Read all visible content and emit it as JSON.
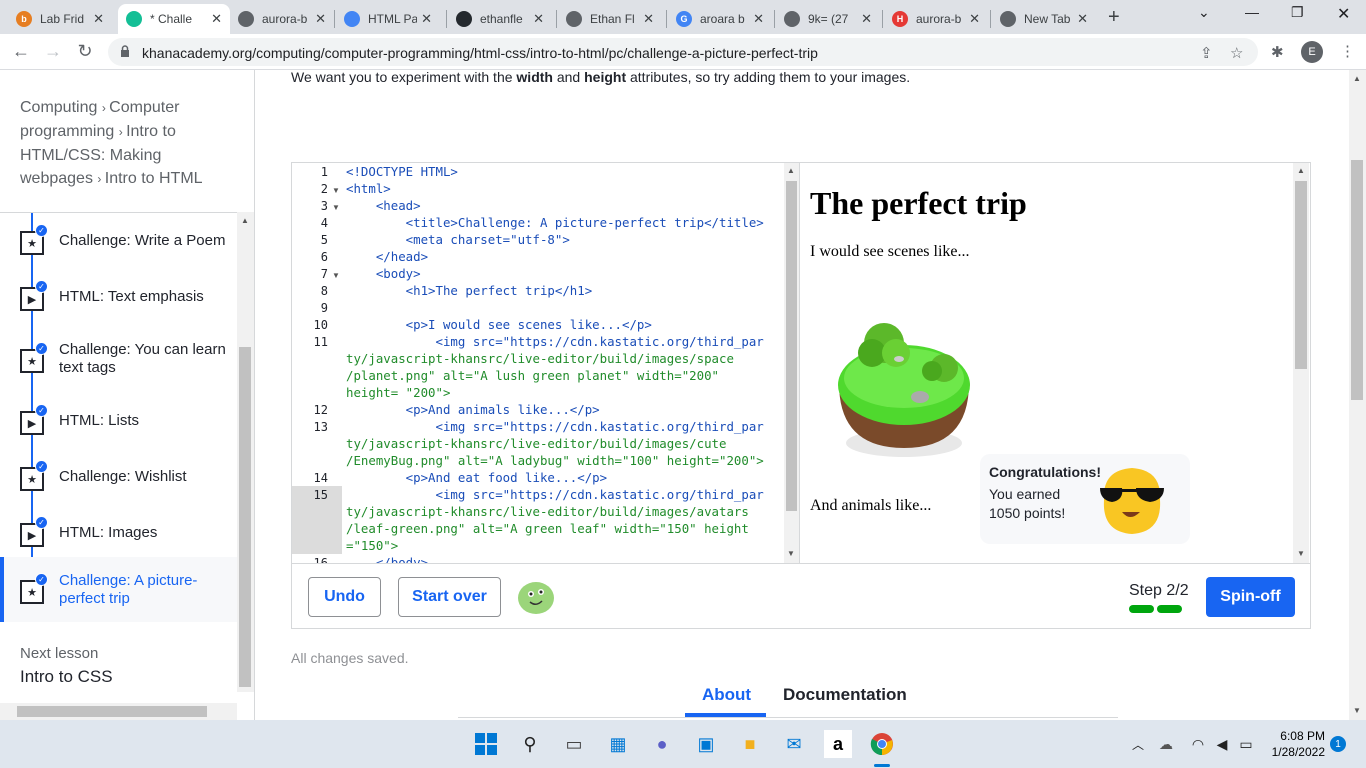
{
  "browser": {
    "tabs": [
      {
        "title": "Lab Frid",
        "icon": "b-icon",
        "color": "#e67e22",
        "glyph": "b",
        "active": false
      },
      {
        "title": "* Challe",
        "icon": "khan-icon",
        "color": "#14bf96",
        "glyph": "",
        "active": true
      },
      {
        "title": "aurora-b",
        "icon": "github-icon",
        "color": "#5f6368",
        "glyph": "",
        "active": false
      },
      {
        "title": "HTML Pa",
        "icon": "docs-icon",
        "color": "#4285f4",
        "glyph": "",
        "active": false
      },
      {
        "title": "ethanfle",
        "icon": "github-icon",
        "color": "#24292e",
        "glyph": "",
        "active": false
      },
      {
        "title": "Ethan Fl",
        "icon": "github-icon",
        "color": "#5f6368",
        "glyph": "",
        "active": false
      },
      {
        "title": "aroara b",
        "icon": "google-icon",
        "color": "#4285f4",
        "glyph": "G",
        "active": false
      },
      {
        "title": "9k= (27",
        "icon": "globe-icon",
        "color": "#5f6368",
        "glyph": "",
        "active": false
      },
      {
        "title": "aurora-b",
        "icon": "h-icon",
        "color": "#e53935",
        "glyph": "H",
        "active": false
      },
      {
        "title": "New Tab",
        "icon": "chrome-icon",
        "color": "#5f6368",
        "glyph": "",
        "active": false
      }
    ],
    "url": "khanacademy.org/computing/computer-programming/html-css/intro-to-html/pc/challenge-a-picture-perfect-trip",
    "profile_initial": "E"
  },
  "sidebar": {
    "breadcrumb": [
      "Computing",
      "Computer programming",
      "Intro to HTML/CSS: Making webpages",
      "Intro to HTML"
    ],
    "items": [
      {
        "label": "Challenge: Write a Poem",
        "type": "challenge",
        "current": false
      },
      {
        "label": "HTML: Text emphasis",
        "type": "talkthrough",
        "current": false
      },
      {
        "label": "Challenge: You can learn text tags",
        "type": "challenge",
        "current": false
      },
      {
        "label": "HTML: Lists",
        "type": "talkthrough",
        "current": false
      },
      {
        "label": "Challenge: Wishlist",
        "type": "challenge",
        "current": false
      },
      {
        "label": "HTML: Images",
        "type": "talkthrough",
        "current": false
      },
      {
        "label": "Challenge: A picture-perfect trip",
        "type": "challenge",
        "current": true
      }
    ],
    "next_lesson_label": "Next lesson",
    "next_lesson_name": "Intro to CSS"
  },
  "content": {
    "intro_pre": "We want you to experiment with the ",
    "intro_b1": "width",
    "intro_mid": " and ",
    "intro_b2": "height",
    "intro_post": " attributes, so try adding them to your images."
  },
  "editor": {
    "line_numbers": [
      "1",
      "2",
      "3",
      "4",
      "5",
      "6",
      "7",
      "8",
      "9",
      "10",
      "11",
      "12",
      "13",
      "14",
      "15",
      "16"
    ],
    "lines": [
      "<!DOCTYPE HTML>",
      "<html>",
      "    <head>",
      "        <title>Challenge: A picture-perfect trip</title>",
      "        <meta charset=\"utf-8\">",
      "    </head>",
      "    <body>",
      "        <h1>The perfect trip</h1>",
      "",
      "        <p>I would see scenes like...</p>",
      "            <img src=\"https://cdn.kastatic.org/third_par",
      "ty/javascript-khansrc/live-editor/build/images/space",
      "/planet.png\" alt=\"A lush green planet\" width=\"200\"",
      "height= \"200\">",
      "        <p>And animals like...</p>",
      "            <img src=\"https://cdn.kastatic.org/third_par",
      "ty/javascript-khansrc/live-editor/build/images/cute",
      "/EnemyBug.png\" alt=\"A ladybug\" width=\"100\" height=\"200\">",
      "        <p>And eat food like...</p>",
      "            <img src=\"https://cdn.kastatic.org/third_par",
      "ty/javascript-khansrc/live-editor/build/images/avatars",
      "/leaf-green.png\" alt=\"A green leaf\" width=\"150\" height",
      "=\"150\">",
      "    </body>"
    ]
  },
  "preview": {
    "h1": "The perfect trip",
    "p1": "I would see scenes like...",
    "p2": "And animals like...",
    "congrats_title": "Congratulations!",
    "congrats_body": "You earned 1050 points!"
  },
  "toolbar": {
    "undo": "Undo",
    "start_over": "Start over",
    "step": "Step 2/2",
    "spinoff": "Spin-off"
  },
  "status": {
    "saved": "All changes saved."
  },
  "page_tabs": {
    "about": "About",
    "documentation": "Documentation"
  },
  "taskbar": {
    "time": "6:08 PM",
    "date": "1/28/2022",
    "notif": "1"
  }
}
